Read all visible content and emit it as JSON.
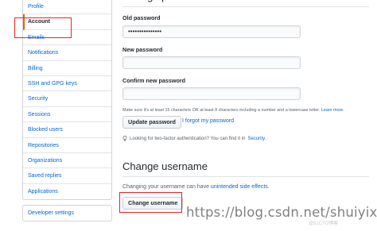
{
  "sidebar": {
    "items": [
      {
        "label": "Profile",
        "selected": false
      },
      {
        "label": "Account",
        "selected": true
      },
      {
        "label": "Emails",
        "selected": false
      },
      {
        "label": "Notifications",
        "selected": false
      },
      {
        "label": "Billing",
        "selected": false
      },
      {
        "label": "SSH and GPG keys",
        "selected": false
      },
      {
        "label": "Security",
        "selected": false
      },
      {
        "label": "Sessions",
        "selected": false
      },
      {
        "label": "Blocked users",
        "selected": false
      },
      {
        "label": "Repositories",
        "selected": false
      },
      {
        "label": "Organizations",
        "selected": false
      },
      {
        "label": "Saved replies",
        "selected": false
      },
      {
        "label": "Applications",
        "selected": false
      }
    ],
    "developer_settings": "Developer settings"
  },
  "change_password": {
    "heading": "Change password",
    "old_label": "Old password",
    "old_value": "•••••••••••••••",
    "new_label": "New password",
    "new_value": "",
    "confirm_label": "Confirm new password",
    "confirm_value": "",
    "requirements_note": "Make sure it's at least 15 characters OR at least 8 characters including a number and a lowercase letter.",
    "learn_more": "Learn more.",
    "update_button": "Update password",
    "forgot_link": "I forgot my password",
    "two_factor_hint": "Looking for two-factor authentication? You can find it in",
    "security_link": "Security",
    "hint_end": "."
  },
  "change_username": {
    "heading": "Change username",
    "text_before": "Changing your username can have",
    "side_effects_link": "unintended side effects",
    "text_after": ".",
    "button": "Change username"
  },
  "watermark": "https://blog.csdn.net/shuiyixin",
  "watermark_small": "@51CTO博客",
  "colors": {
    "highlight": "#e5252a",
    "link": "#0366d6",
    "accent": "#e36209"
  }
}
